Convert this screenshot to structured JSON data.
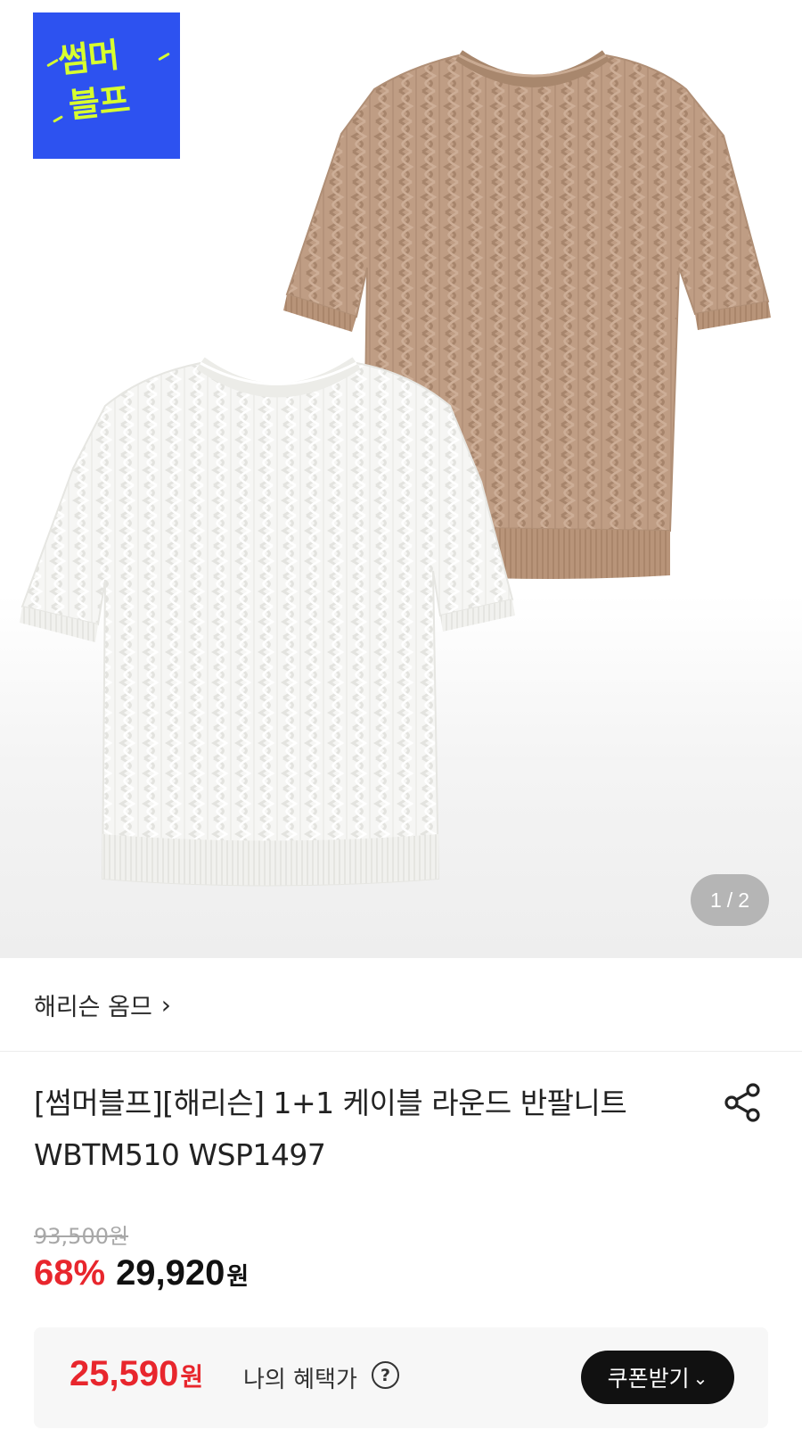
{
  "badge": {
    "line1": "썸머",
    "line2": "블프",
    "bg_color": "#2d52f0",
    "text_color": "#d8ff2e"
  },
  "gallery": {
    "current": "1",
    "separator": "/",
    "total": "2"
  },
  "brand": {
    "name": "해리슨 옴므",
    "chevron_icon": "chevron-right-icon"
  },
  "product": {
    "title": "[썸머블프][해리슨] 1+1 케이블 라운드 반팔니트 WBTM510 WSP1497",
    "share_icon": "share-icon"
  },
  "pricing": {
    "original_price": "93,500원",
    "discount": "68%",
    "sale_price": "29,920",
    "currency": "원",
    "accent_color": "#e8262d"
  },
  "benefit": {
    "price": "25,590",
    "currency": "원",
    "label": "나의 혜택가",
    "help_icon": "question-circle-icon",
    "coupon_button": "쿠폰받기",
    "coupon_chevron": "chevron-down-icon"
  }
}
